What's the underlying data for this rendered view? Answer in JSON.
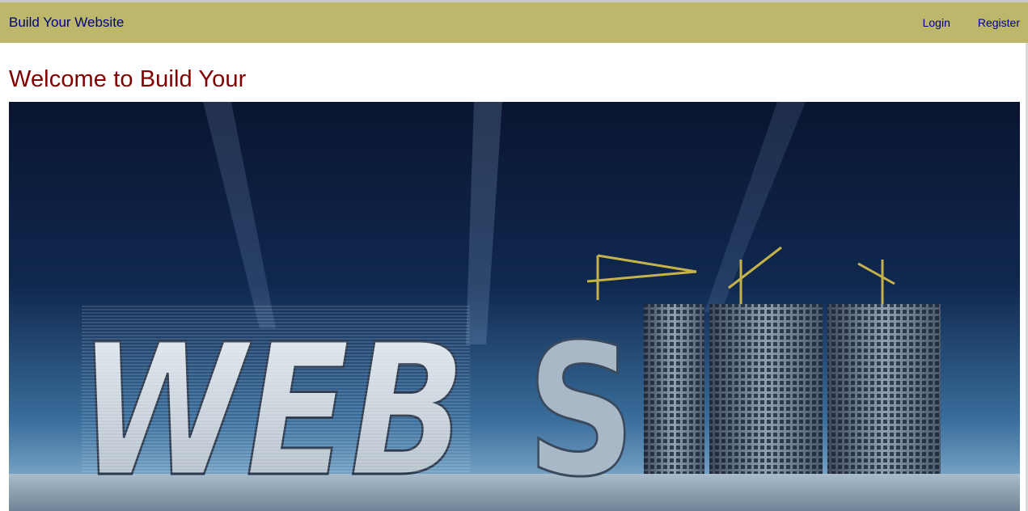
{
  "navbar": {
    "brand": "Build Your Website",
    "links": [
      {
        "label": "Login"
      },
      {
        "label": "Register"
      }
    ]
  },
  "main": {
    "heading": "Welcome to Build Your",
    "hero_image": {
      "alt": "WEB SITE"
    }
  },
  "colors": {
    "navbar_bg": "#bdb76b",
    "link": "#000080",
    "heading": "#800000"
  }
}
